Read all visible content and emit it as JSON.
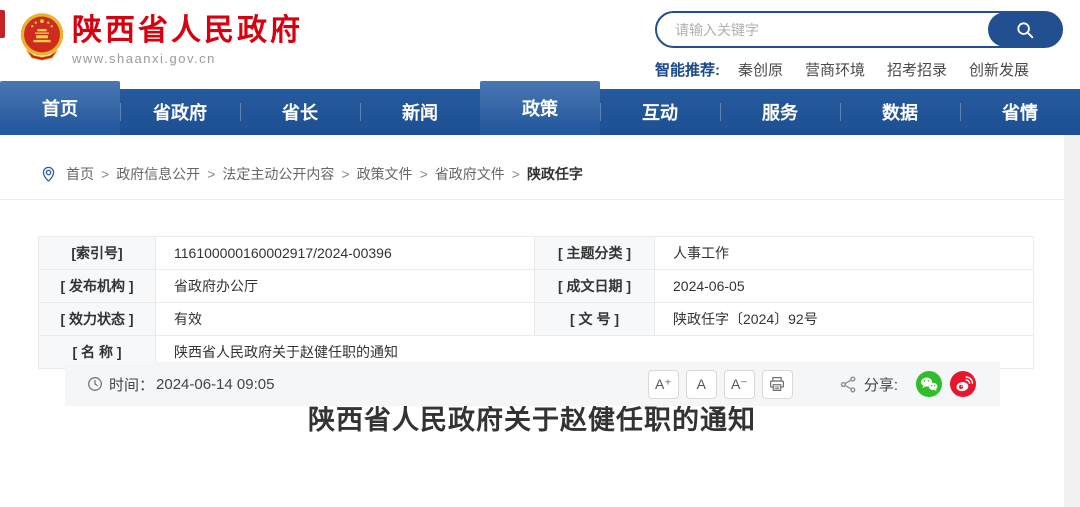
{
  "header": {
    "site_name": "陕西省人民政府",
    "site_url": "www.shaanxi.gov.cn",
    "search": {
      "placeholder": "请输入关键字"
    },
    "recommend_label": "智能推荐:",
    "recommend_links": [
      "秦创原",
      "营商环境",
      "招考招录",
      "创新发展"
    ]
  },
  "nav": {
    "items": [
      {
        "label": "首页",
        "raised": true
      },
      {
        "label": "省政府",
        "raised": false
      },
      {
        "label": "省长",
        "raised": false
      },
      {
        "label": "新闻",
        "raised": false
      },
      {
        "label": "政策",
        "raised": true
      },
      {
        "label": "互动",
        "raised": false
      },
      {
        "label": "服务",
        "raised": false
      },
      {
        "label": "数据",
        "raised": false
      },
      {
        "label": "省情",
        "raised": false
      }
    ]
  },
  "breadcrumb": {
    "separator": ">",
    "items": [
      "首页",
      "政府信息公开",
      "法定主动公开内容",
      "政策文件",
      "省政府文件",
      "陕政任字"
    ]
  },
  "meta_table": {
    "index_label": "[索引号]",
    "index_value": "116100000160002917/2024-00396",
    "topic_label": "[ 主题分类 ]",
    "topic_value": "人事工作",
    "agency_label": "[ 发布机构 ]",
    "agency_value": "省政府办公厅",
    "date_label": "[ 成文日期 ]",
    "date_value": "2024-06-05",
    "validity_label": "[ 效力状态 ]",
    "validity_value": "有效",
    "docnum_label": "[ 文 号 ]",
    "docnum_value": "陕政任字〔2024〕92号",
    "name_label": "[ 名 称 ]",
    "name_value": "陕西省人民政府关于赵健任职的通知"
  },
  "article": {
    "title": "陕西省人民政府关于赵健任职的通知",
    "time_label": "时间：",
    "time_value": "2024-06-14 09:05"
  },
  "toolbar": {
    "font_increase": "A⁺",
    "font_normal": "A",
    "font_decrease": "A⁻"
  },
  "share": {
    "label": "分享:"
  },
  "icons": {
    "logo": "national-emblem",
    "search": "magnifier-icon",
    "breadcrumb": "location-pin-icon",
    "time": "clock-icon",
    "print": "printer-icon",
    "share": "share-nodes-icon",
    "wechat": "wechat-icon",
    "weibo": "weibo-icon"
  },
  "colors": {
    "brand_red": "#d6000f",
    "nav_blue": "#1d5092",
    "nav_tab_highlight": "#4a77b1",
    "search_navy": "#224f8f",
    "wechat_green": "#2dbe2a",
    "weibo_red": "#e6162d",
    "info_bar_bg": "#f5f6f8"
  }
}
